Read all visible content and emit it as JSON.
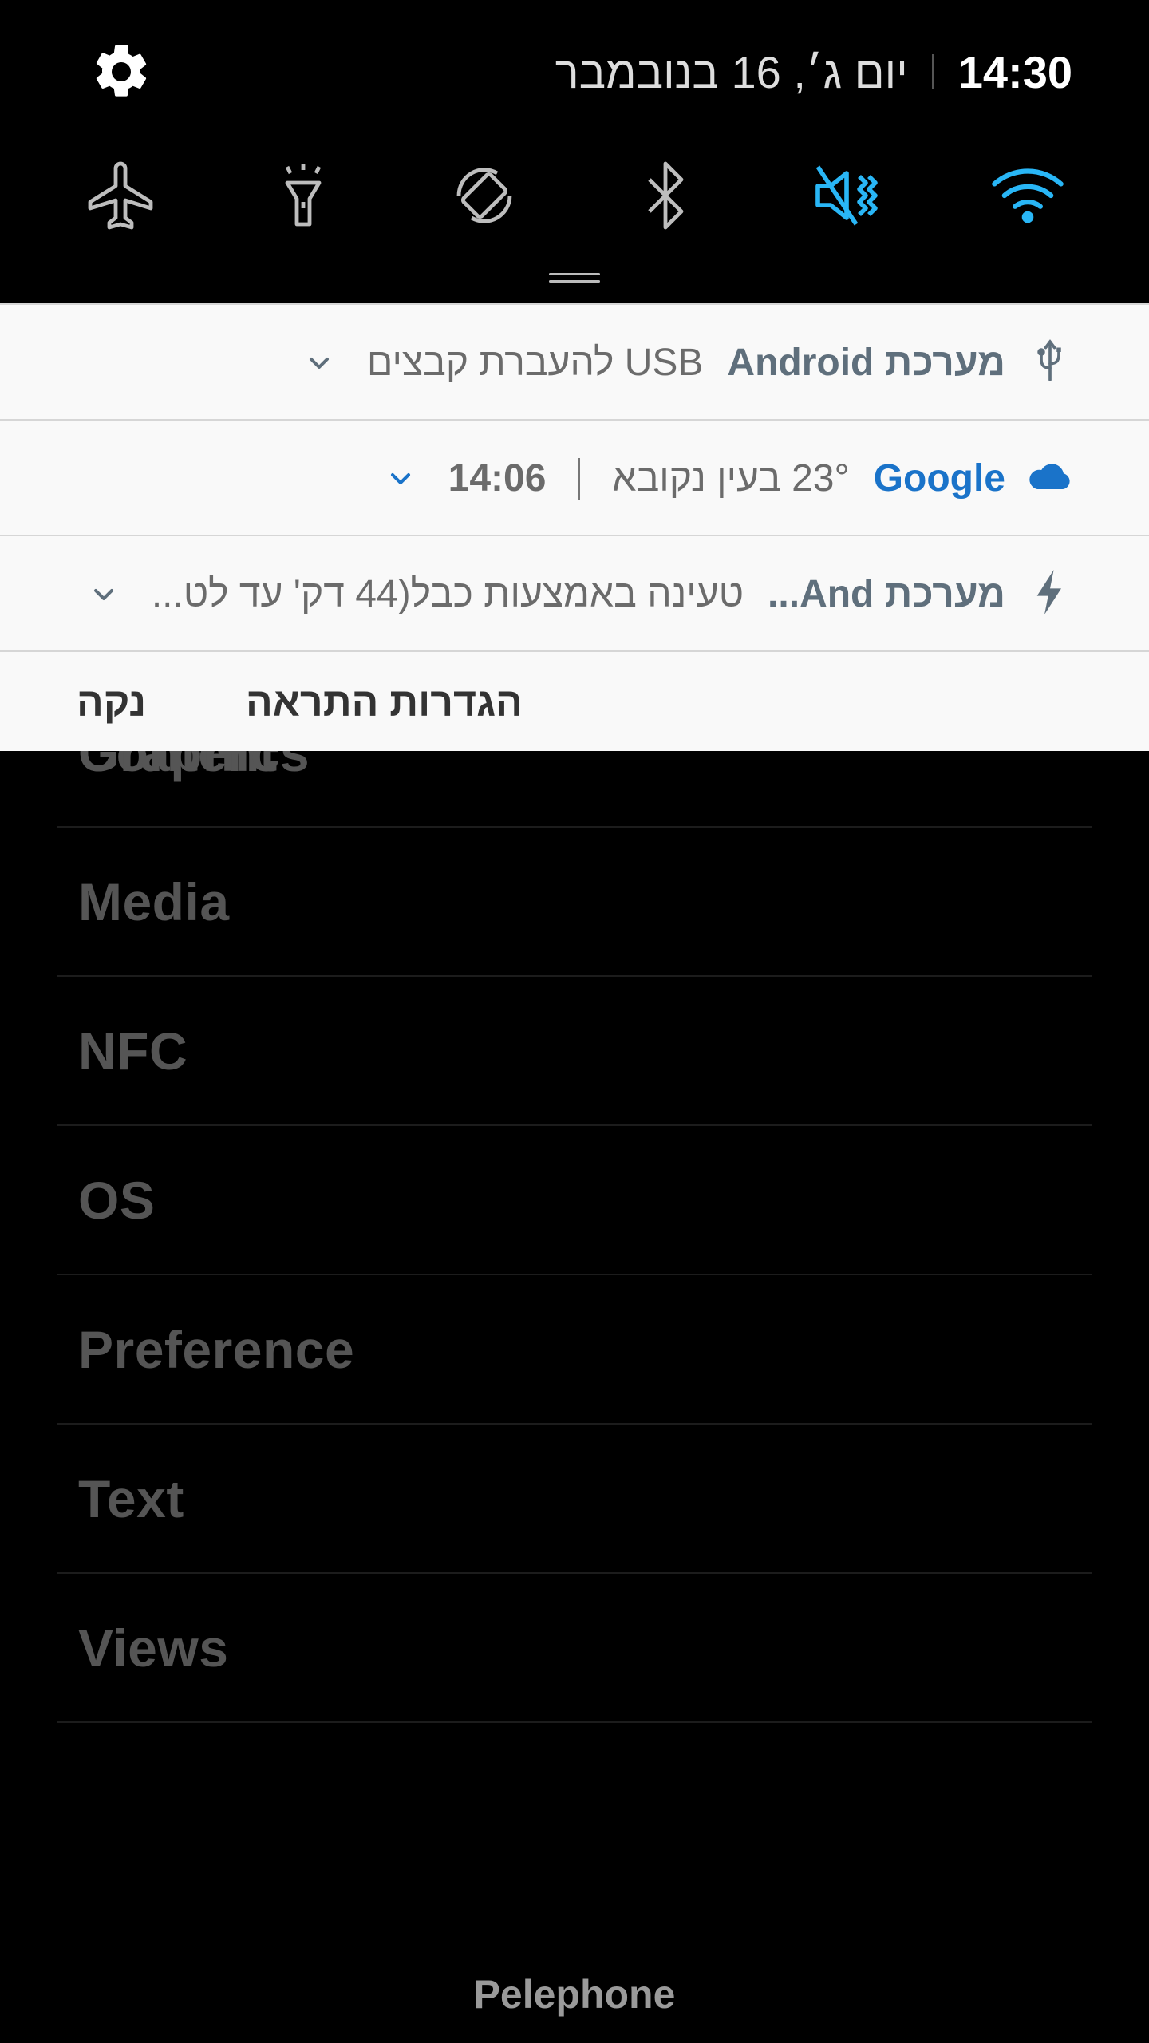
{
  "status_bar": {
    "time": "14:30",
    "date": "יום ג׳, 16 בנובמבר"
  },
  "quick_toggles": [
    {
      "name": "wifi",
      "icon": "wifi-icon",
      "active": true
    },
    {
      "name": "sound",
      "icon": "mute-vibrate-icon",
      "active": true
    },
    {
      "name": "bluetooth",
      "icon": "bluetooth-icon",
      "active": false
    },
    {
      "name": "auto-rotate",
      "icon": "rotate-icon",
      "active": false
    },
    {
      "name": "flashlight",
      "icon": "flashlight-icon",
      "active": false
    },
    {
      "name": "airplane",
      "icon": "airplane-icon",
      "active": false
    }
  ],
  "notifications": [
    {
      "app": "מערכת Android",
      "message": "USB להעברת קבצים",
      "icon": "usb-icon"
    },
    {
      "app": "Google",
      "message": "23° בעין נקובא",
      "time": "14:06",
      "icon": "cloud-icon"
    },
    {
      "app": "מערכת And...",
      "message": "טעינה באמצעות כבל(44 דק' עד לט...",
      "icon": "bolt-icon"
    }
  ],
  "actions": {
    "settings": "הגדרות התראה",
    "clear": "נקה"
  },
  "background_list": {
    "peek": "Content",
    "items": [
      "Graphics",
      "Media",
      "NFC",
      "OS",
      "Preference",
      "Text",
      "Views"
    ]
  },
  "carrier": "Pelephone",
  "colors": {
    "accent": "#29b6f6",
    "google_blue": "#1a73c9",
    "card_bg": "#f9f9f9"
  }
}
